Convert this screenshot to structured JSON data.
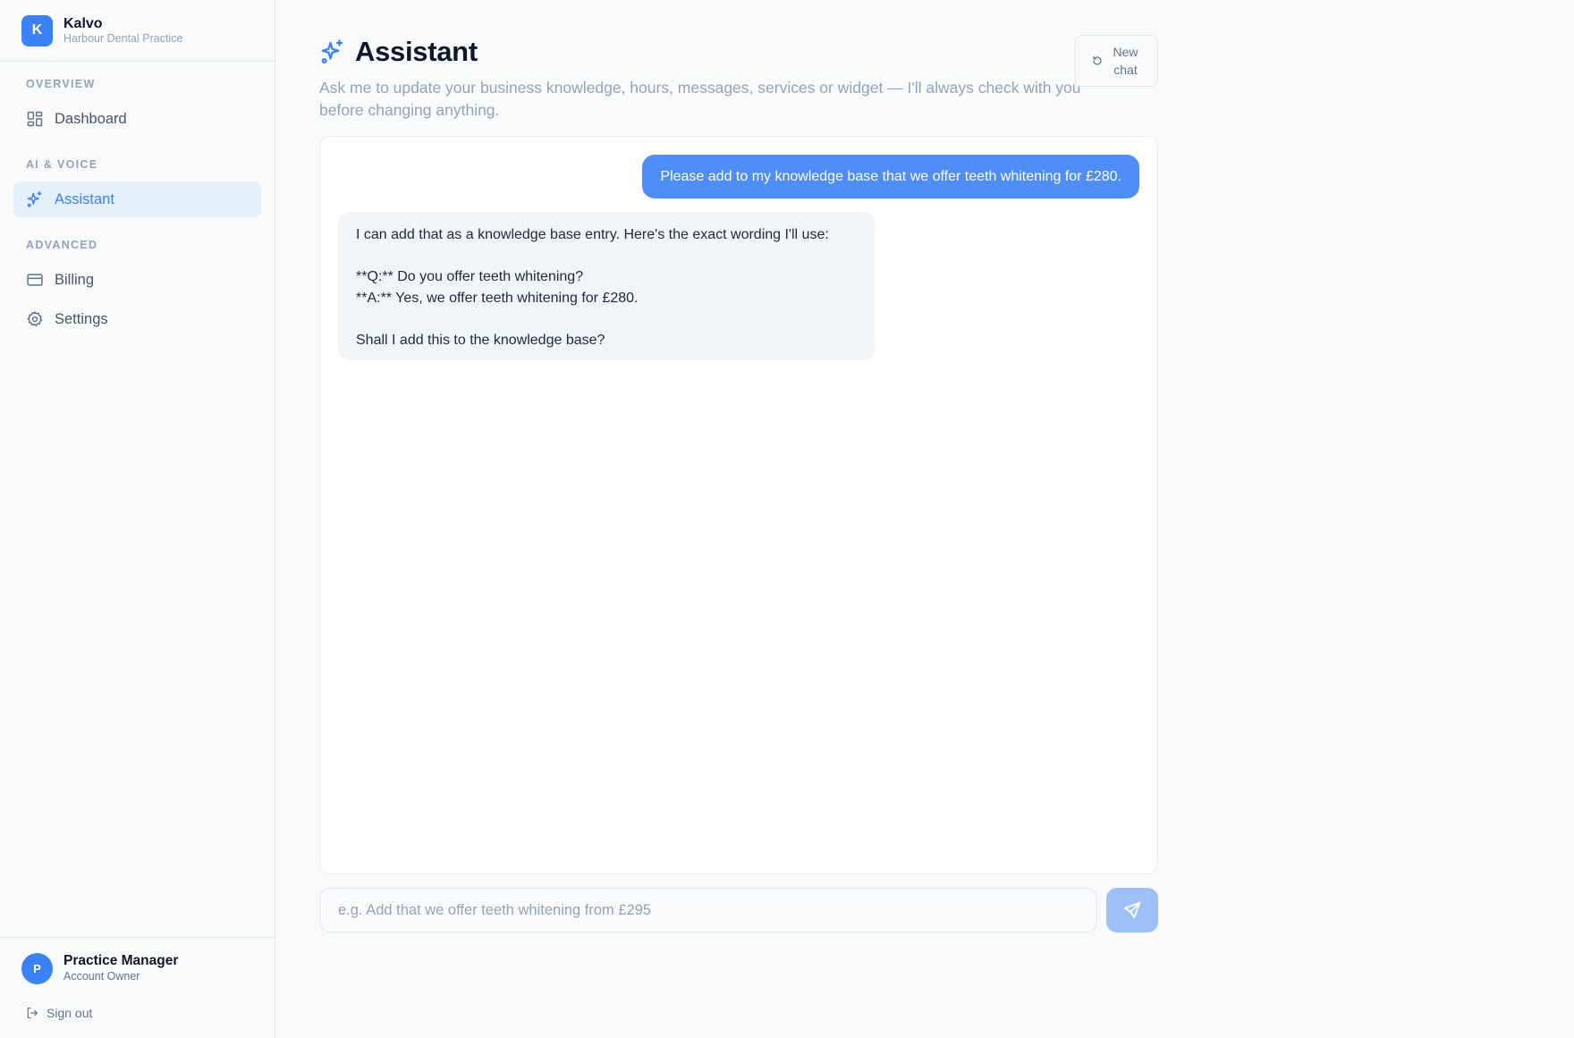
{
  "brand": {
    "initial": "K",
    "name": "Kalvo",
    "subtitle": "Harbour Dental Practice"
  },
  "sidebar": {
    "sections": [
      {
        "label": "OVERVIEW",
        "items": [
          {
            "label": "Dashboard",
            "icon": "dashboard-icon"
          }
        ]
      },
      {
        "label": "AI & VOICE",
        "items": [
          {
            "label": "Assistant",
            "icon": "sparkles-icon",
            "active": true
          }
        ]
      },
      {
        "label": "ADVANCED",
        "items": [
          {
            "label": "Billing",
            "icon": "credit-card-icon"
          },
          {
            "label": "Settings",
            "icon": "gear-icon"
          }
        ]
      }
    ]
  },
  "user": {
    "initial": "P",
    "name": "Practice Manager",
    "role": "Account Owner",
    "signout_label": "Sign out"
  },
  "header": {
    "title": "Assistant",
    "subtitle": "Ask me to update your business knowledge, hours, messages, services or widget — I'll always check with you before changing anything.",
    "new_chat_label": "New chat"
  },
  "chat": {
    "user_message": "Please add to my knowledge base that we offer teeth whitening for £280.",
    "assistant_lines": [
      "I can add that as a knowledge base entry. Here's the exact wording I'll use:",
      "",
      "**Q:** Do you offer teeth whitening?",
      "**A:** Yes, we offer teeth whitening for £280.",
      "",
      "Shall I add this to the knowledge base?"
    ]
  },
  "composer": {
    "placeholder": "e.g. Add that we offer teeth whitening from £295",
    "value": ""
  },
  "colors": {
    "accent": "#3b82f6",
    "user_bubble": "#4f8ef7",
    "send_disabled": "#9dc0f9"
  }
}
